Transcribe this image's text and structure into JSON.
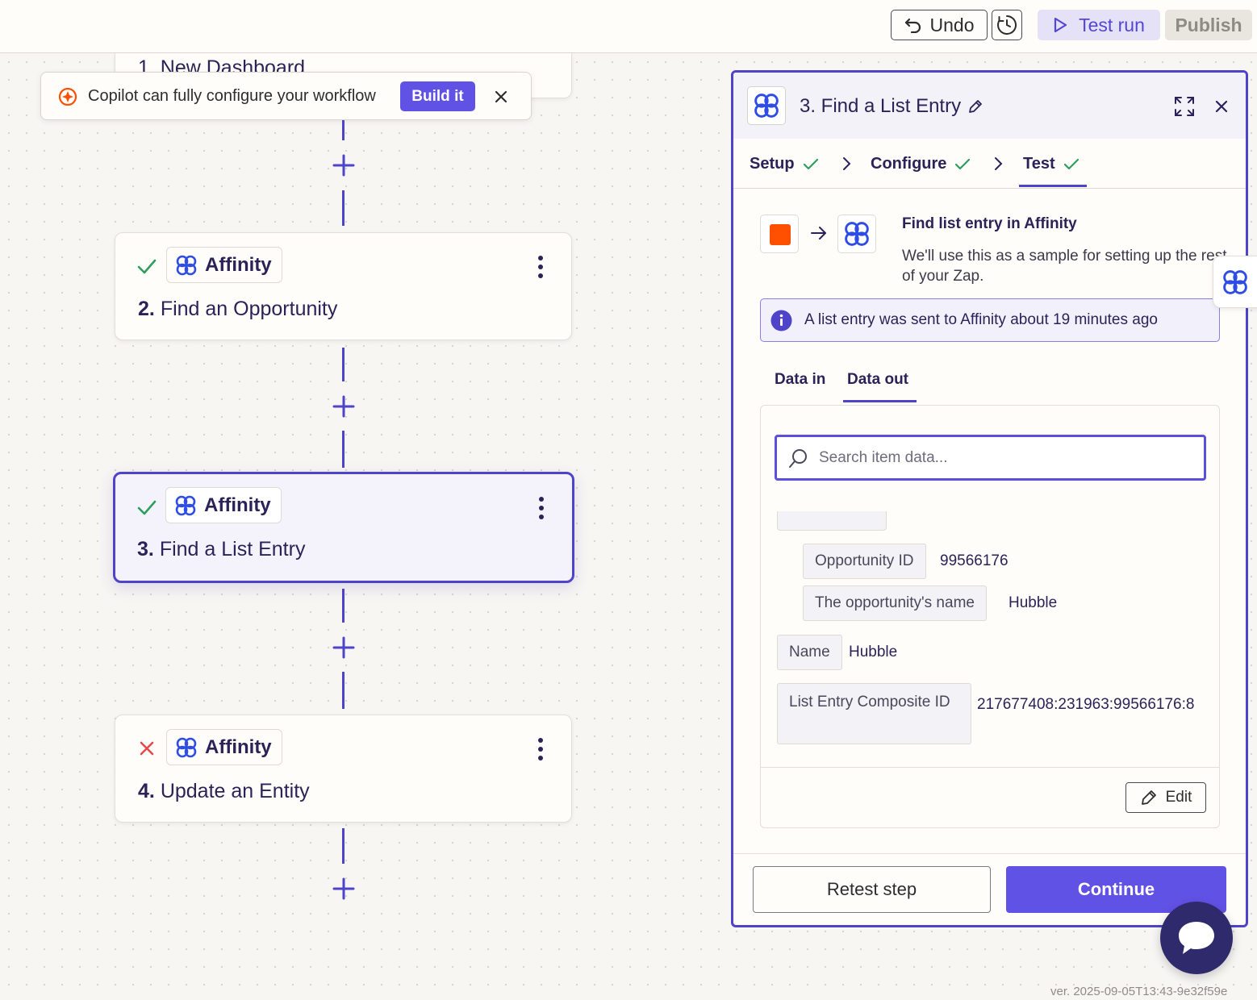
{
  "toolbar": {
    "undo_label": "Undo",
    "test_run_label": "Test run",
    "publish_label": "Publish"
  },
  "copilot": {
    "message": "Copilot can fully configure your workflow",
    "build_label": "Build it"
  },
  "canvas": {
    "partial_step_title": "1. New Dashboard",
    "steps": [
      {
        "number": "2.",
        "title": "Find an Opportunity",
        "app": "Affinity",
        "status": "success"
      },
      {
        "number": "3.",
        "title": "Find a List Entry",
        "app": "Affinity",
        "status": "success",
        "selected": true
      },
      {
        "number": "4.",
        "title": "Update an Entity",
        "app": "Affinity",
        "status": "error"
      }
    ]
  },
  "panel": {
    "title": "3. Find a List Entry",
    "tabs": [
      {
        "label": "Setup",
        "done": true
      },
      {
        "label": "Configure",
        "done": true
      },
      {
        "label": "Test",
        "done": true,
        "active": true
      }
    ],
    "sample": {
      "title": "Find list entry in Affinity",
      "description": "We'll use this as a sample for setting up the rest of your Zap."
    },
    "info_banner": "A list entry was sent to Affinity about 19 minutes ago",
    "data_tabs": [
      {
        "label": "Data in"
      },
      {
        "label": "Data out",
        "active": true
      }
    ],
    "search_placeholder": "Search item data...",
    "fields": [
      {
        "key": "Opportunity ID",
        "value": "99566176"
      },
      {
        "key": "The opportunity's name",
        "value": "Hubble"
      },
      {
        "key": "Name",
        "value": "Hubble"
      },
      {
        "key": "List Entry Composite ID",
        "value": "217677408:231963:99566176:8"
      }
    ],
    "edit_label": "Edit",
    "retest_label": "Retest step",
    "continue_label": "Continue"
  },
  "footer": {
    "version": "ver. 2025-09-05T13:43-9e32f59e"
  },
  "colors": {
    "accent": "#6152e6",
    "accent_dark": "#4f43c9",
    "success": "#2e9e5b",
    "error": "#e5484d",
    "zapier_orange": "#ff4f00"
  }
}
